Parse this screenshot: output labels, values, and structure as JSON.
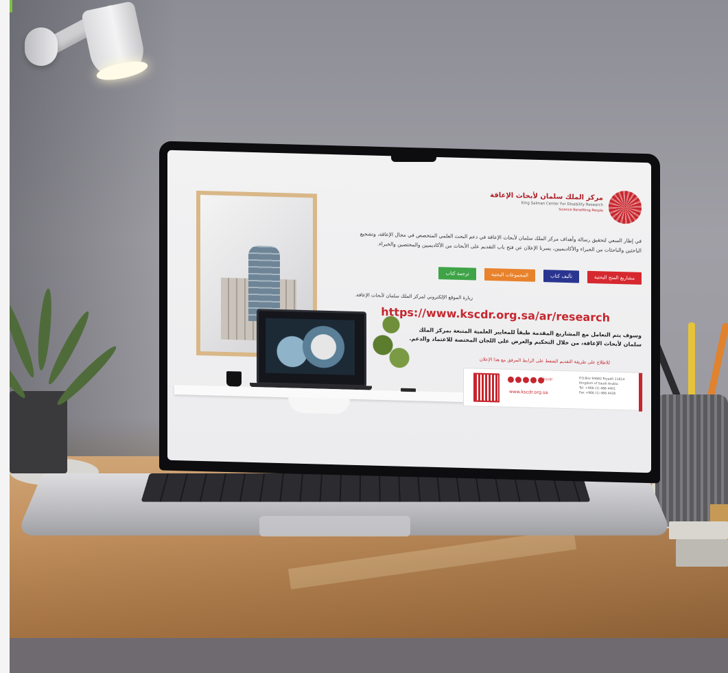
{
  "screen": {
    "logo": {
      "name_ar": "مركز الملك سلمان لأبحاث الإعاقة",
      "name_en": "King Salman Center For Disability Research",
      "slogan_en": "Science Benefiting People"
    },
    "intro_text": "في إطار السعي لتحقيق رسالة وأهداف مركز الملك سلمان لأبحاث الإعاقة في دعم البحث العلمي المتخصص في مجال الإعاقة، وتشجيع الباحثين والباحثات من الخبراء والأكاديميين، يسرنا الإعلان عن فتح باب التقديم على الأبحاث من الأكاديميين والمختصين والخبراء.",
    "buttons": [
      {
        "label": "مشاريع المنح البحثية",
        "color": "#d6282f"
      },
      {
        "label": "تأليف كتاب",
        "color": "#2a3590"
      },
      {
        "label": "المجموعات البحثية",
        "color": "#e8822b"
      },
      {
        "label": "ترجمة كتاب",
        "color": "#3fa447"
      }
    ],
    "visit_text": "زيارة الموقع الإلكتروني لمركز الملك سلمان لأبحاث الإعاقة.",
    "url": "https://www.kscdr.org.sa/ar/research",
    "deal_text": "وسوف يتم التعامل مع المشاريع المقدمة طبقاً للمعايير العلمية المتبعة بمركز الملك سلمان لأبحاث الإعاقة، من خلال التحكيم والعرض على اللجان المختصة للاعتماد والدعم.",
    "apply_text": "للاطلاع على طريقة التقديم الضغط على الرابط المرفق مع هذا الإعلان",
    "contact": {
      "handle": "kscdr",
      "website": "www.kscdr.org.sa",
      "address": "P.O.Box 94682 Riyadh 11614\nKingdom of Saudi Arabia\nTel. +966 (1) 488 4401\nFax +966 (1) 488 4428"
    }
  },
  "colors": {
    "brand_red": "#c6262e",
    "accent_green": "#7bc043",
    "desk_wood": "#c59462"
  }
}
